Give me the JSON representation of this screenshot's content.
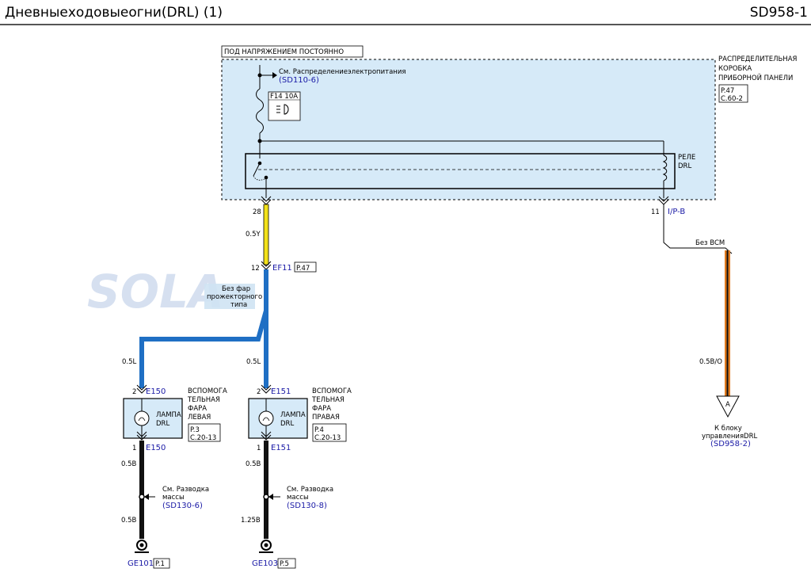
{
  "header": {
    "title": "Дневныеходовыеогни(DRL) (1)",
    "code": "SD958-1"
  },
  "hot_label": "ПОД НАПРЯЖЕНИЕМ ПОСТОЯННО",
  "junction_box": {
    "lines": [
      "РАСПРЕДЕЛИТЕЛЬНАЯ",
      "КОРОБКА",
      "ПРИБОРНОЙ ПАНЕЛИ"
    ],
    "ref1": "P.47",
    "ref2": "C.60-2"
  },
  "power_ref": {
    "text": "См. Распределениеэлектропитания",
    "link": "(SD110-6)"
  },
  "fuse": {
    "label": "F14 10A"
  },
  "relay": {
    "line1": "РЕЛЕ",
    "line2": "DRL"
  },
  "pins": {
    "p28": "28",
    "p11": "11",
    "p12": "12",
    "p2l": "2",
    "p2r": "2",
    "p1l": "1",
    "p1r": "1"
  },
  "conn_ip": "I/P-B",
  "wires": {
    "w1": "0.5Y",
    "w2": "0.5L",
    "w3": "0.5L",
    "w4": "0.5B",
    "w5": "0.5B",
    "w6": "0.5B",
    "w7": "1.25B",
    "w8": "0.5B/O"
  },
  "ef11": {
    "name": "EF11",
    "ref": "P.47"
  },
  "no_fog": {
    "lines": [
      "Без фар",
      "прожекторного",
      "типа"
    ]
  },
  "no_bcm": "Без BCM",
  "watermark": "SOLA",
  "lamp_left": {
    "conn_top": "E150",
    "conn_bottom": "E150",
    "title": [
      "ВСПОМОГА",
      "ТЕЛЬНАЯ",
      "ФАРА",
      "ЛЕВАЯ"
    ],
    "inner": [
      "ЛАМПА",
      "DRL"
    ],
    "ref1": "P.3",
    "ref2": "C.20-13"
  },
  "lamp_right": {
    "conn_top": "E151",
    "conn_bottom": "E151",
    "title": [
      "ВСПОМОГА",
      "ТЕЛЬНАЯ",
      "ФАРА",
      "ПРАВАЯ"
    ],
    "inner": [
      "ЛАМПА",
      "DRL"
    ],
    "ref1": "P.4",
    "ref2": "C.20-13"
  },
  "ground_left": {
    "lines": [
      "См. Разводка",
      "массы"
    ],
    "link": "(SD130-6)",
    "point": "GE101",
    "ref": "P.1"
  },
  "ground_right": {
    "lines": [
      "См. Разводка",
      "массы"
    ],
    "link": "(SD130-8)",
    "point": "GE103",
    "ref": "P.5"
  },
  "offpage": {
    "letter": "A",
    "lines": [
      "К блоку",
      "управленияDRL"
    ],
    "link": "(SD958-2)"
  },
  "colors": {
    "box_fill": "#d6eaf8",
    "wire_yellow": "#f2e11a",
    "wire_blue": "#1f6fc4",
    "wire_black": "#111111",
    "wire_orange": "#e07a1e",
    "link_text": "#1a1aa6"
  }
}
